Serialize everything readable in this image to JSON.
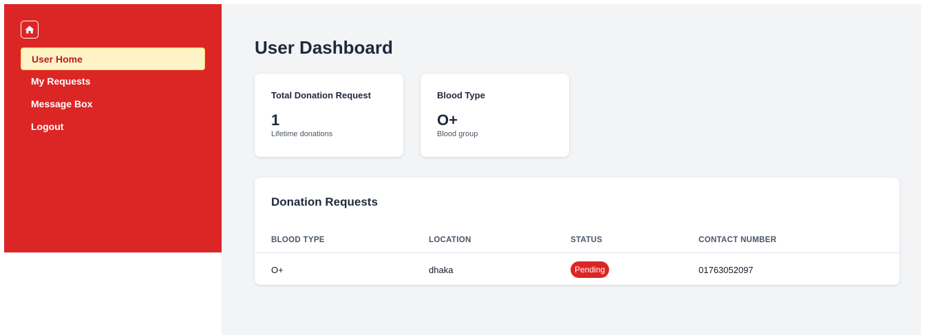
{
  "sidebar": {
    "home_icon": "home-icon",
    "items": [
      {
        "label": "User Home",
        "active": true
      },
      {
        "label": "My Requests",
        "active": false
      },
      {
        "label": "Message Box",
        "active": false
      },
      {
        "label": "Logout",
        "active": false
      }
    ],
    "color": "#dc2626"
  },
  "main": {
    "title": "User Dashboard",
    "stats": [
      {
        "label": "Total Donation Request",
        "value": "1",
        "sub": "Lifetime donations"
      },
      {
        "label": "Blood Type",
        "value": "O+",
        "sub": "Blood group"
      }
    ],
    "table": {
      "title": "Donation Requests",
      "headers": [
        "BLOOD TYPE",
        "LOCATION",
        "STATUS",
        "CONTACT NUMBER"
      ],
      "rows": [
        {
          "blood_type": "O+",
          "location": "dhaka",
          "status": "Pending",
          "contact": "01763052097"
        }
      ]
    }
  }
}
